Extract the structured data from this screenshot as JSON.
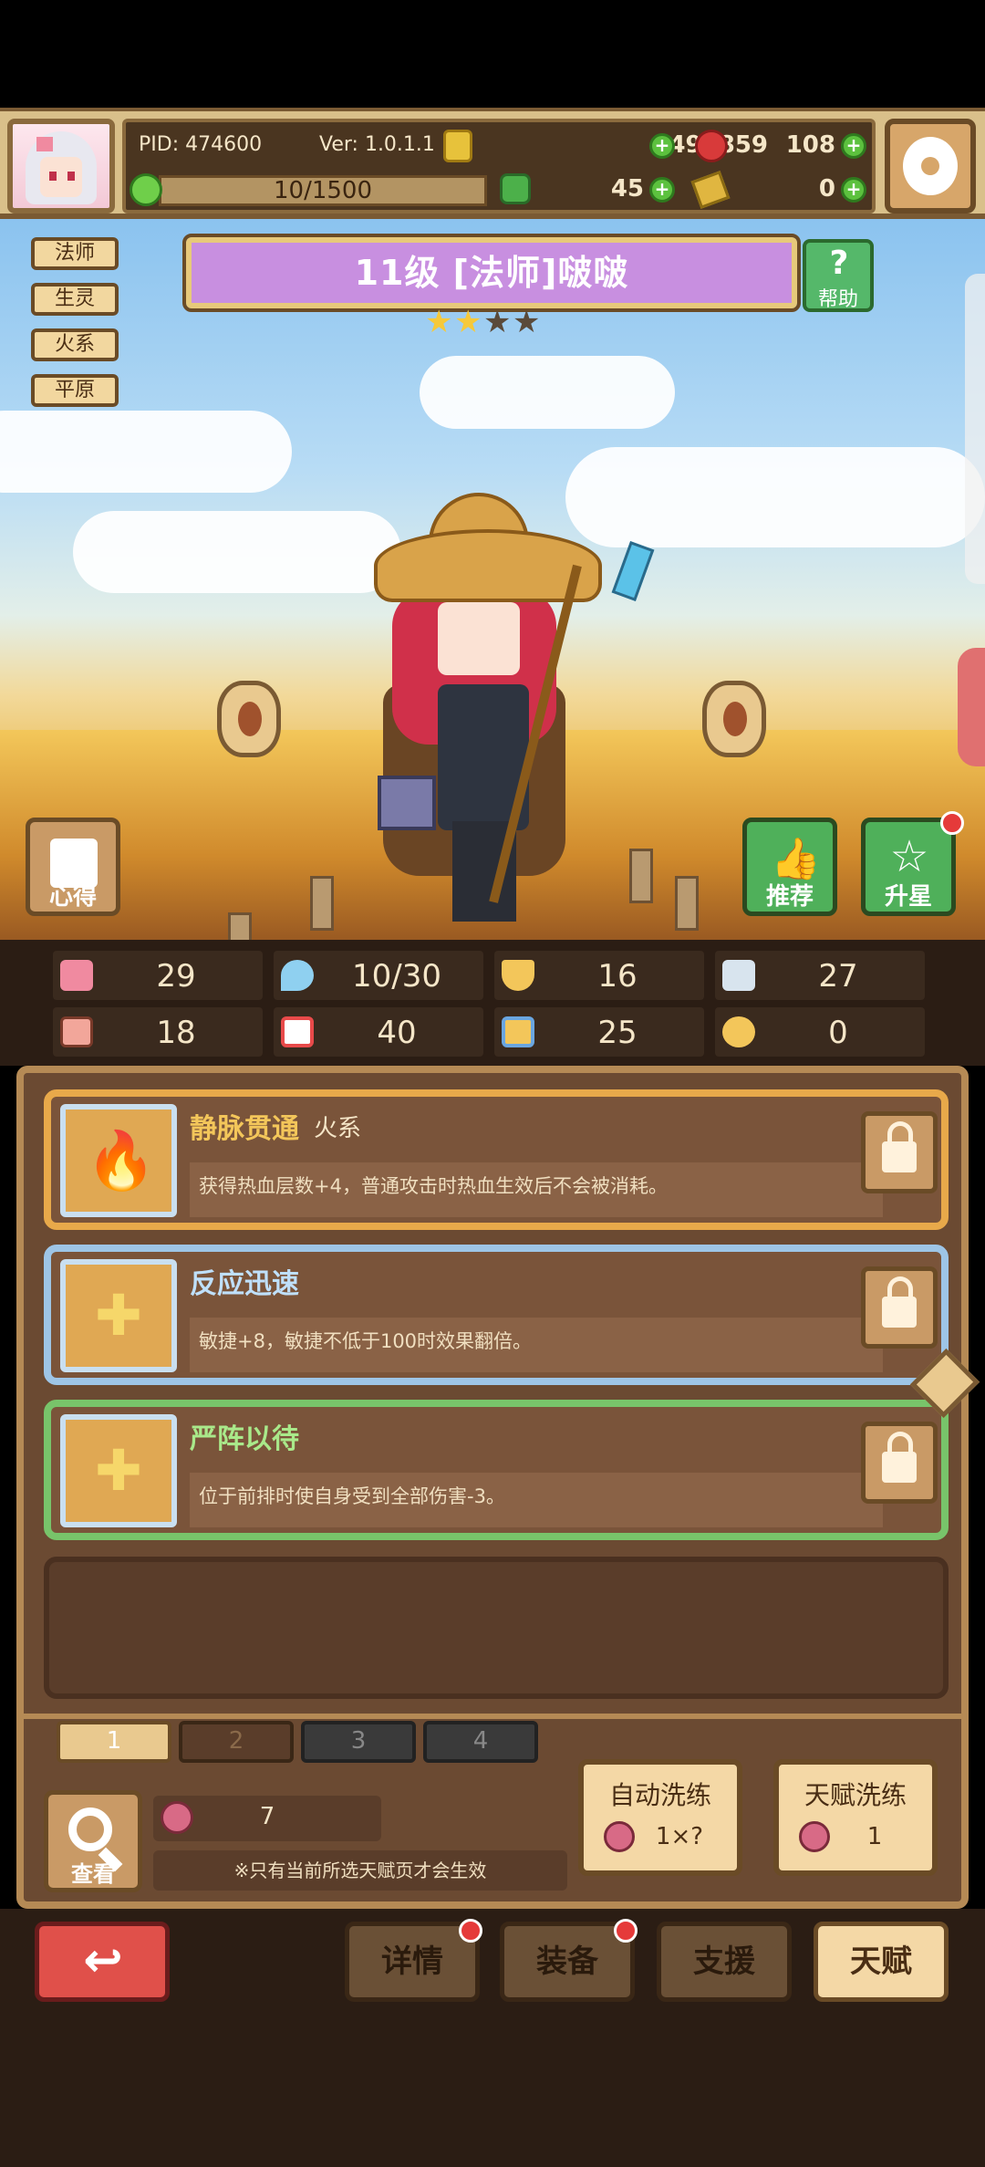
{
  "top_bar": {
    "pid": "PID: 474600",
    "version": "Ver: 1.0.1.1",
    "gold": "494859",
    "gems": "108",
    "energy": "10/1500",
    "clover": "45",
    "keys": "0"
  },
  "hero": {
    "tags": [
      "法师",
      "生灵",
      "火系",
      "平原"
    ],
    "title": "11级 [法师]啵啵",
    "help_label": "帮助",
    "stars_filled": 2,
    "stars_total": 4,
    "buttons": {
      "insight": "心得",
      "recommend": "推荐",
      "star_up": "升星"
    }
  },
  "stats": [
    {
      "icon": "heart-icon",
      "value": "29",
      "color": "#f08aa0"
    },
    {
      "icon": "mana-drop-icon",
      "value": "10/30",
      "color": "#8fd0f0"
    },
    {
      "icon": "shield-icon",
      "value": "16",
      "color": "#f3c65a"
    },
    {
      "icon": "speed-wing-icon",
      "value": "27",
      "color": "#d8e4ee"
    },
    {
      "icon": "fist-icon",
      "value": "18",
      "color": "#f2a69a"
    },
    {
      "icon": "spellbook-icon",
      "value": "40",
      "color": "#e84a4a"
    },
    {
      "icon": "scroll-icon",
      "value": "25",
      "color": "#6aa6e0"
    },
    {
      "icon": "lucky-charm-icon",
      "value": "0",
      "color": "#f3c65a"
    }
  ],
  "talents": [
    {
      "name": "静脉贯通",
      "element": "火系",
      "desc": "获得热血层数+4，普通攻击时热血生效后不会被消耗。",
      "icon": "flame-icon"
    },
    {
      "name": "反应迅速",
      "element": "",
      "desc": "敏捷+8，敏捷不低于100时效果翻倍。",
      "icon": "cross-icon"
    },
    {
      "name": "严阵以待",
      "element": "",
      "desc": "位于前排时使自身受到全部伤害-3。",
      "icon": "cross-icon"
    }
  ],
  "pages": [
    "1",
    "2",
    "3",
    "4"
  ],
  "bottom_panel": {
    "search_label": "查看",
    "potion_count": "7",
    "note": "※只有当前所选天赋页才会生效",
    "auto_wash_label": "自动洗练",
    "auto_wash_cost": "1×?",
    "talent_wash_label": "天赋洗练",
    "talent_wash_cost": "1"
  },
  "nav": {
    "details": "详情",
    "equipment": "装备",
    "support": "支援",
    "talent": "天赋"
  }
}
